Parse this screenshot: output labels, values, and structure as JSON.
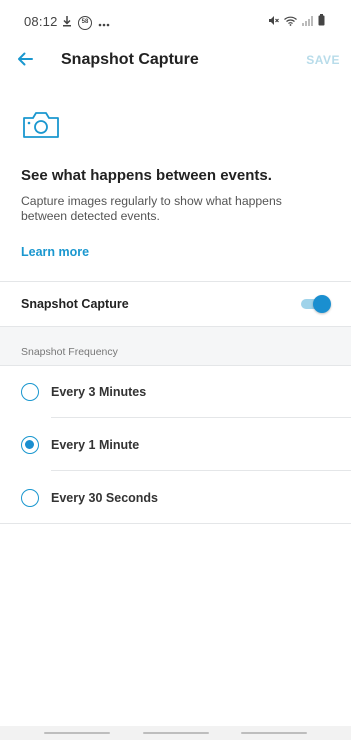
{
  "status_bar": {
    "time": "08:12",
    "left_icons": [
      "download-icon",
      "notification-badge-icon",
      "more-dots-icon"
    ],
    "notification_badge": "58",
    "right_icons": [
      "mute-icon",
      "wifi-icon",
      "signal-icon",
      "battery-icon"
    ]
  },
  "app_bar": {
    "back_icon": "arrow-left-icon",
    "title": "Snapshot Capture",
    "save_label": "SAVE"
  },
  "intro": {
    "icon": "camera-icon",
    "heading": "See what happens between events.",
    "body": "Capture images regularly to show what happens between detected events.",
    "link": "Learn more"
  },
  "toggle_setting": {
    "label": "Snapshot Capture",
    "enabled": true
  },
  "frequency": {
    "header": "Snapshot Frequency",
    "options": [
      {
        "label": "Every 3 Minutes",
        "selected": false
      },
      {
        "label": "Every 1 Minute",
        "selected": true
      },
      {
        "label": "Every 30 Seconds",
        "selected": false
      }
    ]
  },
  "colors": {
    "accent": "#1a97cf",
    "save_disabled": "#b8dcea",
    "section_bg": "#f5f6f7"
  }
}
